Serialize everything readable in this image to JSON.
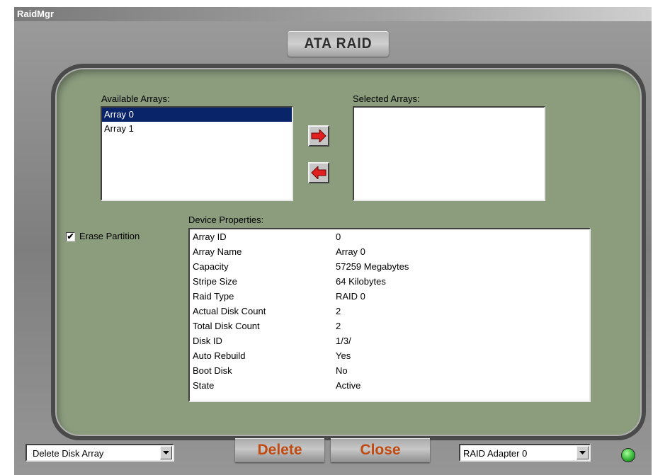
{
  "window": {
    "title": "RaidMgr"
  },
  "header": {
    "title": "ATA RAID"
  },
  "available_arrays": {
    "label": "Available Arrays:",
    "items": [
      "Array 0",
      "Array 1"
    ],
    "selected": "Array 0"
  },
  "selected_arrays": {
    "label": "Selected Arrays:",
    "items": []
  },
  "buttons": {
    "move_right": "right-arrow-icon",
    "move_left": "left-arrow-icon"
  },
  "erase_partition": {
    "label": "Erase Partition",
    "checked": true,
    "mark": "✔"
  },
  "device_properties": {
    "label": "Device Properties:",
    "rows": [
      {
        "key": "Array ID",
        "value": "0"
      },
      {
        "key": "Array Name",
        "value": "Array 0"
      },
      {
        "key": "Capacity",
        "value": "57259 Megabytes"
      },
      {
        "key": "Stripe Size",
        "value": "64 Kilobytes"
      },
      {
        "key": "Raid Type",
        "value": "RAID 0"
      },
      {
        "key": "Actual Disk Count",
        "value": "2"
      },
      {
        "key": "Total Disk Count",
        "value": "2"
      },
      {
        "key": "Disk ID",
        "value": "1/3/"
      },
      {
        "key": "Auto Rebuild",
        "value": "Yes"
      },
      {
        "key": "Boot Disk",
        "value": "No"
      },
      {
        "key": "State",
        "value": "Active"
      }
    ]
  },
  "bottom": {
    "operation_select": "Delete Disk Array",
    "delete_label": "Delete",
    "close_label": "Close",
    "adapter_select": "RAID Adapter 0",
    "status_led_color": "#2fb030"
  },
  "colors": {
    "panel": "#8c9d7e",
    "selection": "#0a246a",
    "action_text": "#c04a10",
    "arrow_red": "#e02020"
  }
}
